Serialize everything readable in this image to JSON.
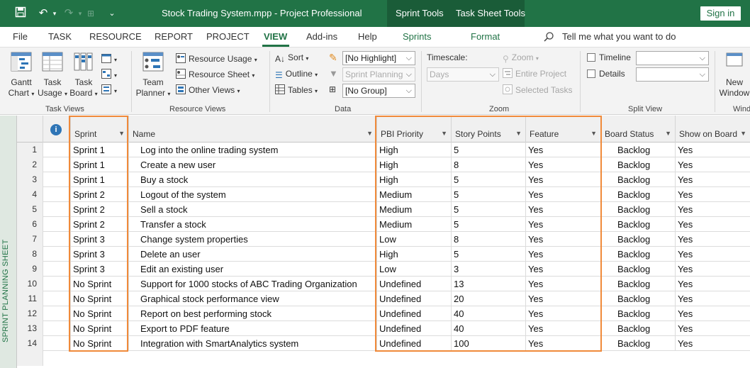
{
  "titlebar": {
    "document_title": "Stock Trading System.mpp  -  Project Professional",
    "context_tabs": [
      "Sprint Tools",
      "Task Sheet Tools"
    ],
    "sign_in": "Sign in"
  },
  "ribbon_tabs": [
    "File",
    "TASK",
    "RESOURCE",
    "REPORT",
    "PROJECT",
    "VIEW",
    "Add-ins",
    "Help",
    "Sprints",
    "Format"
  ],
  "active_tab": "VIEW",
  "tell_me": "Tell me what you want to do",
  "task_views": {
    "group_label": "Task Views",
    "gantt_line1": "Gantt",
    "gantt_line2": "Chart",
    "usage_line1": "Task",
    "usage_line2": "Usage",
    "board_line1": "Task",
    "board_line2": "Board"
  },
  "resource_views": {
    "group_label": "Resource Views",
    "team_line1": "Team",
    "team_line2": "Planner",
    "resource_usage": "Resource Usage",
    "resource_sheet": "Resource Sheet",
    "other_views": "Other Views"
  },
  "data_group": {
    "group_label": "Data",
    "sort": "Sort",
    "outline": "Outline",
    "tables": "Tables",
    "highlight": "[No Highlight]",
    "filter": "Sprint Planning",
    "group": "[No Group]"
  },
  "zoom_group": {
    "group_label": "Zoom",
    "timescale_label": "Timescale:",
    "timescale_value": "Days",
    "zoom": "Zoom",
    "entire_project": "Entire Project",
    "selected_tasks": "Selected Tasks"
  },
  "split_view": {
    "group_label": "Split View",
    "timeline": "Timeline",
    "details": "Details"
  },
  "window_group": {
    "new_line1": "New",
    "new_line2": "Window",
    "group_label": "Windo"
  },
  "sheet": {
    "side_label": "SPRINT PLANNING SHEET",
    "columns": [
      "Sprint",
      "Name",
      "PBI Priority",
      "Story Points",
      "Feature",
      "Board Status",
      "Show on Board"
    ],
    "rows": [
      {
        "num": "1",
        "sprint": "Sprint 1",
        "name": "Log into the online trading system",
        "priority": "High",
        "points": "5",
        "feature": "Yes",
        "status": "Backlog",
        "show": "Yes"
      },
      {
        "num": "2",
        "sprint": "Sprint 1",
        "name": "Create a new user",
        "priority": "High",
        "points": "8",
        "feature": "Yes",
        "status": "Backlog",
        "show": "Yes"
      },
      {
        "num": "3",
        "sprint": "Sprint 1",
        "name": "Buy a stock",
        "priority": "High",
        "points": "5",
        "feature": "Yes",
        "status": "Backlog",
        "show": "Yes"
      },
      {
        "num": "4",
        "sprint": "Sprint 2",
        "name": "Logout of the system",
        "priority": "Medium",
        "points": "5",
        "feature": "Yes",
        "status": "Backlog",
        "show": "Yes"
      },
      {
        "num": "5",
        "sprint": "Sprint 2",
        "name": "Sell a stock",
        "priority": "Medium",
        "points": "5",
        "feature": "Yes",
        "status": "Backlog",
        "show": "Yes"
      },
      {
        "num": "6",
        "sprint": "Sprint 2",
        "name": "Transfer a stock",
        "priority": "Medium",
        "points": "5",
        "feature": "Yes",
        "status": "Backlog",
        "show": "Yes"
      },
      {
        "num": "7",
        "sprint": "Sprint 3",
        "name": "Change system properties",
        "priority": "Low",
        "points": "8",
        "feature": "Yes",
        "status": "Backlog",
        "show": "Yes"
      },
      {
        "num": "8",
        "sprint": "Sprint 3",
        "name": "Delete an user",
        "priority": "High",
        "points": "5",
        "feature": "Yes",
        "status": "Backlog",
        "show": "Yes"
      },
      {
        "num": "9",
        "sprint": "Sprint 3",
        "name": "Edit an existing user",
        "priority": "Low",
        "points": "3",
        "feature": "Yes",
        "status": "Backlog",
        "show": "Yes"
      },
      {
        "num": "10",
        "sprint": "No Sprint",
        "name": "Support for 1000 stocks of ABC Trading Organization",
        "priority": "Undefined",
        "points": "13",
        "feature": "Yes",
        "status": "Backlog",
        "show": "Yes"
      },
      {
        "num": "11",
        "sprint": "No Sprint",
        "name": "Graphical stock performance view",
        "priority": "Undefined",
        "points": "20",
        "feature": "Yes",
        "status": "Backlog",
        "show": "Yes"
      },
      {
        "num": "12",
        "sprint": "No Sprint",
        "name": "Report on best performing stock",
        "priority": "Undefined",
        "points": "40",
        "feature": "Yes",
        "status": "Backlog",
        "show": "Yes"
      },
      {
        "num": "13",
        "sprint": "No Sprint",
        "name": "Export to PDF feature",
        "priority": "Undefined",
        "points": "40",
        "feature": "Yes",
        "status": "Backlog",
        "show": "Yes"
      },
      {
        "num": "14",
        "sprint": "No Sprint",
        "name": "Integration with SmartAnalytics system",
        "priority": "Undefined",
        "points": "100",
        "feature": "Yes",
        "status": "Backlog",
        "show": "Yes"
      }
    ]
  }
}
